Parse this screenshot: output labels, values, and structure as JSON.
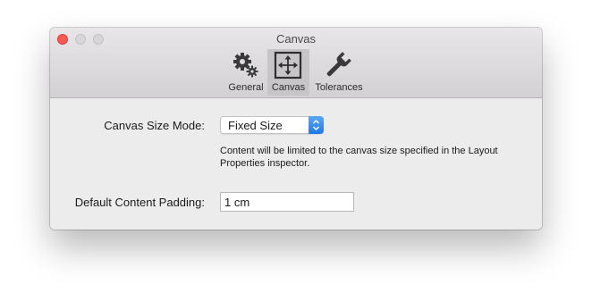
{
  "window": {
    "title": "Canvas"
  },
  "toolbar": {
    "tabs": [
      {
        "label": "General",
        "icon": "gears-icon",
        "active": false
      },
      {
        "label": "Canvas",
        "icon": "canvas-move-icon",
        "active": true
      },
      {
        "label": "Tolerances",
        "icon": "wrench-icon",
        "active": false
      }
    ]
  },
  "content": {
    "size_mode_label": "Canvas Size Mode:",
    "size_mode_value": "Fixed Size",
    "size_mode_description": "Content will be limited to the canvas size specified in the Layout Properties inspector.",
    "padding_label": "Default Content Padding:",
    "padding_value": "1 cm"
  },
  "colors": {
    "close": "#fc5753",
    "accent": "#1a78f0",
    "active_tab": "#c7c5c7"
  }
}
